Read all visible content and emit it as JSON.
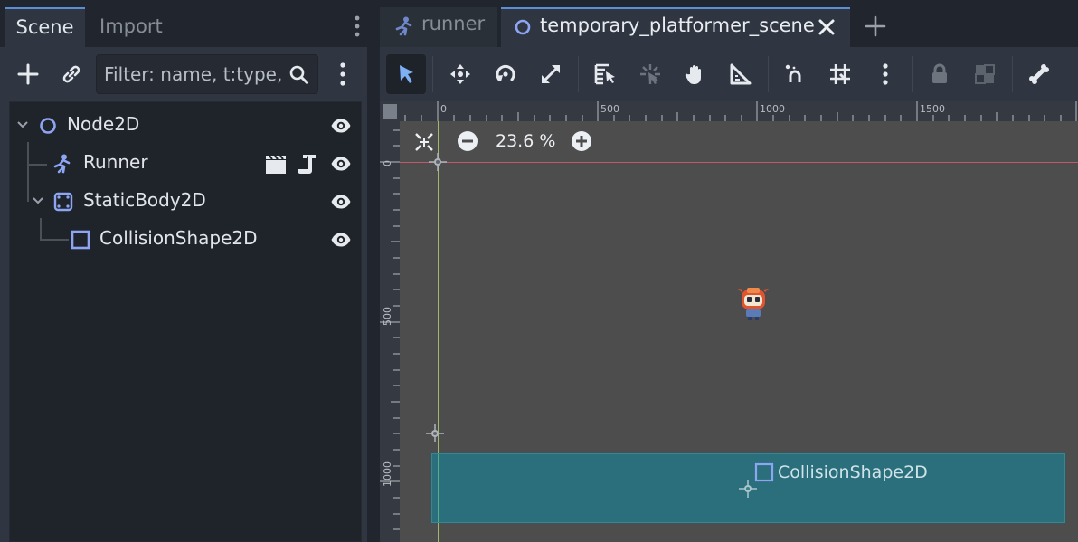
{
  "left_dock": {
    "tabs": [
      {
        "label": "Scene",
        "active": true
      },
      {
        "label": "Import",
        "active": false
      }
    ],
    "filter_placeholder": "Filter: name, t:type,",
    "tree": [
      {
        "name": "Node2D",
        "type": "Node2D",
        "expanded": true,
        "visible": true
      },
      {
        "name": "Runner",
        "type": "CharacterBody2D",
        "badges": [
          "clapperboard-icon",
          "script-icon"
        ],
        "visible": true
      },
      {
        "name": "StaticBody2D",
        "type": "StaticBody2D",
        "expanded": true,
        "visible": true
      },
      {
        "name": "CollisionShape2D",
        "type": "CollisionShape2D",
        "visible": true
      }
    ]
  },
  "scene_tabs": [
    {
      "label": "runner",
      "icon": "runner-icon",
      "active": false
    },
    {
      "label": "temporary_platformer_scene",
      "icon": "node2d-circle-icon",
      "active": true,
      "closable": true
    }
  ],
  "toolbar_tools": [
    {
      "name": "select-tool",
      "active": true
    },
    {
      "name": "move-tool"
    },
    {
      "name": "rotate-tool"
    },
    {
      "name": "scale-tool"
    },
    {
      "name": "list-selectable-tool"
    },
    {
      "name": "pivot-tool"
    },
    {
      "name": "pan-tool"
    },
    {
      "name": "ruler-tool"
    },
    {
      "name": "smart-snap-toggle"
    },
    {
      "name": "grid-snap-toggle"
    },
    {
      "name": "snap-options-menu"
    },
    {
      "name": "lock-tool"
    },
    {
      "name": "group-tool"
    },
    {
      "name": "skeleton-tool"
    }
  ],
  "viewport": {
    "zoom": "23.6 %",
    "ruler_top": [
      "0",
      "500",
      "1000",
      "1500"
    ],
    "ruler_left": [
      "0",
      "500",
      "1000"
    ],
    "collision_label": "CollisionShape2D",
    "colors": {
      "accent": "#5a8fd6",
      "collision_fill": "#0099b3",
      "background": "#4d4d4d",
      "y_axis": "#9fb86a",
      "x_axis": "#c05a6a"
    }
  }
}
